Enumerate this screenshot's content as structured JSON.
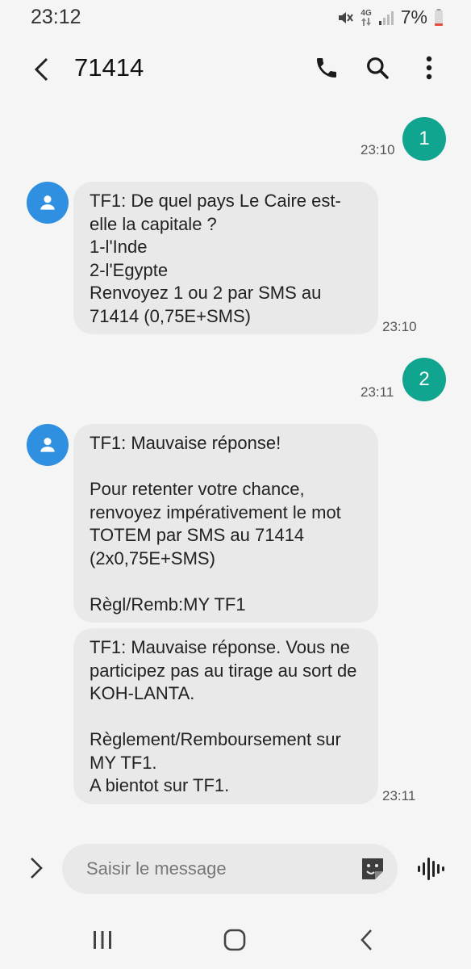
{
  "status_bar": {
    "time": "23:12",
    "network": "4G",
    "battery": "7%"
  },
  "header": {
    "title": "71414",
    "back_icon": "back-arrow-icon",
    "call_icon": "phone-icon",
    "search_icon": "search-icon",
    "menu_icon": "more-vert-icon"
  },
  "messages": [
    {
      "direction": "sent",
      "text": "1",
      "time": "23:10"
    },
    {
      "direction": "received",
      "text": "TF1: De quel pays Le Caire est-elle la capitale ?\n1-l'Inde\n2-l'Egypte\nRenvoyez 1 ou 2 par SMS au 71414 (0,75E+SMS)",
      "time": "23:10"
    },
    {
      "direction": "sent",
      "text": "2",
      "time": "23:11"
    },
    {
      "direction": "received",
      "text": "TF1: Mauvaise réponse!\n\nPour retenter votre chance, renvoyez impérativement le mot TOTEM par SMS au 71414 (2x0,75E+SMS)\n\nRègl/Remb:MY TF1",
      "time": ""
    },
    {
      "direction": "received",
      "text": "TF1: Mauvaise réponse. Vous ne participez pas au tirage au sort de KOH-LANTA.\n\nRèglement/Remboursement sur MY TF1.\nA bientot sur TF1.",
      "time": "23:11"
    }
  ],
  "compose": {
    "placeholder": "Saisir le message",
    "value": ""
  },
  "colors": {
    "sent_badge": "#10a58f",
    "avatar": "#2f8fe0",
    "bubble": "#e9e9e9",
    "background": "#f5f5f5"
  }
}
